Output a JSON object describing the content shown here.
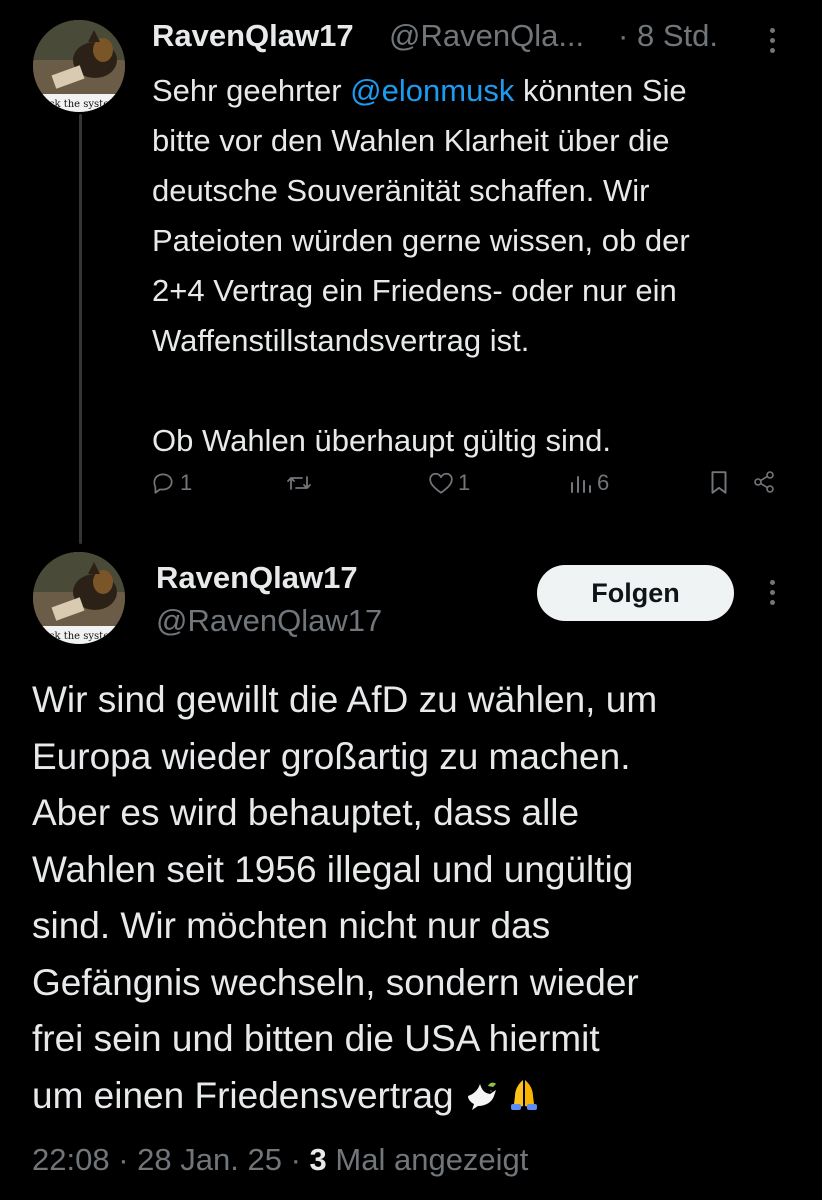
{
  "parent_tweet": {
    "display_name": "RavenQlaw17",
    "handle": "@RavenQla...",
    "separator": "·",
    "time": "8 Std.",
    "avatar_caption": "ck the syste",
    "body_prefix": "Sehr geehrter ",
    "mention": "@elonmusk",
    "body_lines": [
      " könnten Sie",
      "bitte vor den Wahlen Klarheit über die",
      "deutsche Souveränität schaffen. Wir",
      "Pateioten würden gerne wissen, ob der",
      "2+4 Vertrag ein Friedens- oder nur ein",
      "Waffenstillstandsvertrag ist."
    ],
    "body_last": "Ob Wahlen überhaupt gültig sind.",
    "actions": {
      "replies": "1",
      "reposts": "",
      "likes": "1",
      "views": "6"
    }
  },
  "main_tweet": {
    "display_name": "RavenQlaw17",
    "handle": "@RavenQlaw17",
    "avatar_caption": "ck the syste",
    "follow_label": "Folgen",
    "body_lines": [
      "Wir sind gewillt die AfD zu wählen, um",
      "Europa wieder großartig zu machen.",
      "Aber es wird behauptet, dass alle",
      "Wahlen seit 1956 illegal und ungültig",
      "sind. Wir möchten nicht nur das",
      "Gefängnis wechseln, sondern wieder",
      "frei sein und bitten die USA hiermit",
      "um einen Friedensvertrag"
    ],
    "emojis": [
      "dove-emoji",
      "folded-hands-emoji"
    ],
    "time": "22:08",
    "date": "28 Jan. 25",
    "views_count": "3",
    "views_label": "Mal angezeigt",
    "sep": "·"
  },
  "colors": {
    "background": "#000000",
    "text": "#e7e9ea",
    "muted": "#71767b",
    "link": "#1d9bf0",
    "button_bg": "#eff3f4"
  }
}
